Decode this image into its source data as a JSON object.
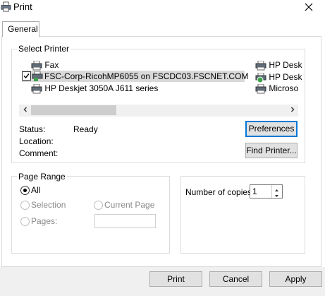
{
  "window": {
    "title": "Print",
    "close_icon": "close-icon",
    "title_icon": "printer-icon"
  },
  "tabs": [
    {
      "label": "General"
    }
  ],
  "select_printer": {
    "group_label": "Select Printer",
    "printers_col1": [
      {
        "name": "Fax",
        "icon": "fax-printer-icon"
      },
      {
        "name": "FSC-Corp-RicohMP6055 on FSCDC03.FSCNET.COM",
        "icon": "network-printer-default-icon",
        "selected": true
      },
      {
        "name": "HP Deskjet 3050A J611 series",
        "icon": "printer-icon"
      }
    ],
    "printers_col2": [
      {
        "name": "HP Desk",
        "icon": "printer-icon"
      },
      {
        "name": "HP Desk",
        "icon": "printer-ready-icon"
      },
      {
        "name": "Microso",
        "icon": "printer-icon"
      }
    ],
    "status_label": "Status:",
    "status_value": "Ready",
    "location_label": "Location:",
    "location_value": "",
    "comment_label": "Comment:",
    "comment_value": "",
    "preferences_button": "Preferences",
    "find_printer_button": "Find Printer..."
  },
  "page_range": {
    "group_label": "Page Range",
    "all_label": "All",
    "selection_label": "Selection",
    "current_page_label": "Current Page",
    "pages_label": "Pages:",
    "pages_value": "",
    "selected": "All"
  },
  "copies": {
    "label": "Number of copies:",
    "value": "1"
  },
  "footer": {
    "print_button": "Print",
    "cancel_button": "Cancel",
    "apply_button": "Apply"
  },
  "colors": {
    "accent": "#0078d7",
    "selected_row": "#d9d9d9",
    "button_bg": "#e1e1e1"
  }
}
